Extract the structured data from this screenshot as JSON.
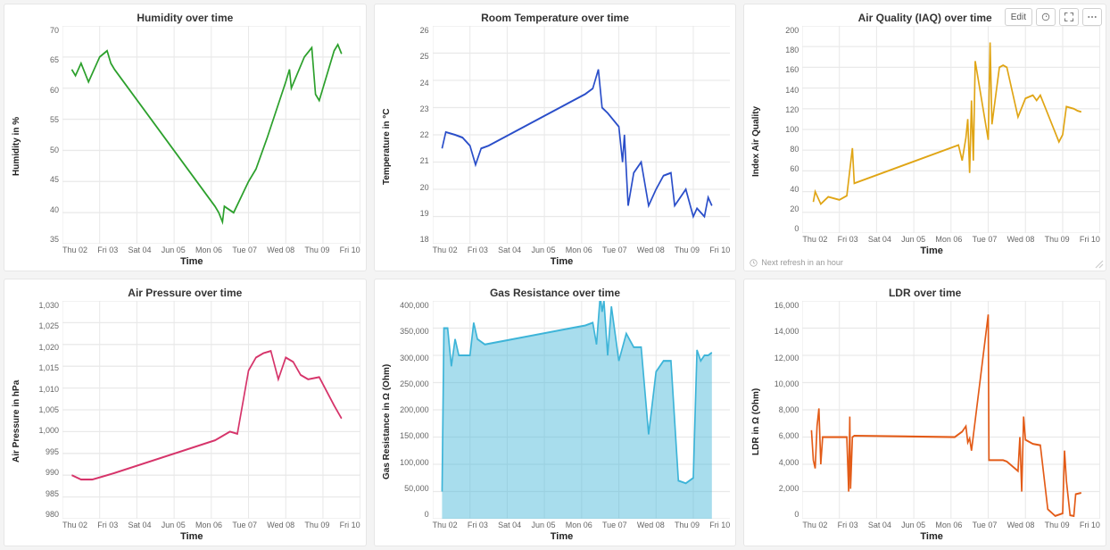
{
  "x_categories": [
    "Thu 02",
    "Fri 03",
    "Sat 04",
    "Jun 05",
    "Mon 06",
    "Tue 07",
    "Wed 08",
    "Thu 09",
    "Fri 10"
  ],
  "xlabel": "Time",
  "toolbar": {
    "edit_label": "Edit"
  },
  "footer": {
    "refresh_label": "Next refresh in an hour"
  },
  "chart_data": [
    {
      "id": "humidity",
      "type": "line",
      "title": "Humidity over time",
      "ylabel": "Humidity in %",
      "ylim": [
        35,
        70
      ],
      "yticks": [
        35,
        40,
        45,
        50,
        55,
        60,
        65,
        70
      ],
      "color": "#2ca02c",
      "series": [
        {
          "name": "humidity",
          "points": [
            [
              0.25,
              63
            ],
            [
              0.35,
              62
            ],
            [
              0.5,
              64
            ],
            [
              0.7,
              61
            ],
            [
              1.0,
              65
            ],
            [
              1.2,
              66
            ],
            [
              1.3,
              64
            ],
            [
              1.4,
              63
            ],
            [
              4.1,
              41
            ],
            [
              4.2,
              40
            ],
            [
              4.3,
              38.5
            ],
            [
              4.35,
              41
            ],
            [
              4.6,
              40
            ],
            [
              5.0,
              45
            ],
            [
              5.2,
              47
            ],
            [
              5.5,
              52
            ],
            [
              6.0,
              61
            ],
            [
              6.1,
              63
            ],
            [
              6.15,
              60
            ],
            [
              6.5,
              65
            ],
            [
              6.7,
              66.5
            ],
            [
              6.8,
              59
            ],
            [
              6.9,
              58
            ],
            [
              7.1,
              62
            ],
            [
              7.3,
              66
            ],
            [
              7.4,
              67
            ],
            [
              7.5,
              65.5
            ]
          ]
        }
      ]
    },
    {
      "id": "room_temp",
      "type": "line",
      "title": "Room Temperature over time",
      "ylabel": "Temperature in °C",
      "ylim": [
        18,
        26
      ],
      "yticks": [
        18,
        19,
        20,
        21,
        22,
        23,
        24,
        25,
        26
      ],
      "color": "#2a4ec9",
      "series": [
        {
          "name": "temp",
          "points": [
            [
              0.25,
              21.5
            ],
            [
              0.35,
              22.1
            ],
            [
              0.6,
              22.0
            ],
            [
              0.8,
              21.9
            ],
            [
              1.0,
              21.6
            ],
            [
              1.15,
              20.9
            ],
            [
              1.3,
              21.5
            ],
            [
              1.5,
              21.6
            ],
            [
              4.1,
              23.5
            ],
            [
              4.3,
              23.7
            ],
            [
              4.45,
              24.4
            ],
            [
              4.55,
              23.0
            ],
            [
              4.7,
              22.8
            ],
            [
              5.0,
              22.3
            ],
            [
              5.1,
              21.0
            ],
            [
              5.15,
              22.0
            ],
            [
              5.25,
              19.4
            ],
            [
              5.4,
              20.6
            ],
            [
              5.6,
              21.0
            ],
            [
              5.8,
              19.4
            ],
            [
              6.0,
              20.0
            ],
            [
              6.2,
              20.5
            ],
            [
              6.4,
              20.6
            ],
            [
              6.5,
              19.4
            ],
            [
              6.8,
              20.0
            ],
            [
              7.0,
              19.0
            ],
            [
              7.1,
              19.3
            ],
            [
              7.3,
              19.0
            ],
            [
              7.4,
              19.7
            ],
            [
              7.5,
              19.4
            ]
          ]
        }
      ]
    },
    {
      "id": "iaq",
      "type": "line",
      "title": "Air Quality (IAQ) over time",
      "ylabel": "Index Air Quality",
      "ylim": [
        0,
        200
      ],
      "yticks": [
        0,
        20,
        40,
        60,
        80,
        100,
        120,
        140,
        160,
        180,
        200
      ],
      "color": "#e0a515",
      "has_toolbar": true,
      "has_footer": true,
      "series": [
        {
          "name": "iaq",
          "points": [
            [
              0.3,
              30
            ],
            [
              0.35,
              40
            ],
            [
              0.5,
              28
            ],
            [
              0.7,
              35
            ],
            [
              1.0,
              32
            ],
            [
              1.2,
              36
            ],
            [
              1.35,
              82
            ],
            [
              1.4,
              48
            ],
            [
              4.2,
              85
            ],
            [
              4.3,
              70
            ],
            [
              4.4,
              92
            ],
            [
              4.45,
              110
            ],
            [
              4.5,
              58
            ],
            [
              4.55,
              128
            ],
            [
              4.6,
              70
            ],
            [
              4.65,
              166
            ],
            [
              5.0,
              90
            ],
            [
              5.05,
              184
            ],
            [
              5.1,
              105
            ],
            [
              5.3,
              160
            ],
            [
              5.4,
              162
            ],
            [
              5.5,
              160
            ],
            [
              5.8,
              112
            ],
            [
              6.0,
              130
            ],
            [
              6.2,
              133
            ],
            [
              6.3,
              128
            ],
            [
              6.4,
              133
            ],
            [
              6.9,
              88
            ],
            [
              7.0,
              95
            ],
            [
              7.1,
              122
            ],
            [
              7.3,
              120
            ],
            [
              7.4,
              118
            ],
            [
              7.5,
              117
            ]
          ]
        }
      ]
    },
    {
      "id": "pressure",
      "type": "line",
      "title": "Air Pressure over time",
      "ylabel": "Air Pressure in hPa",
      "ylim": [
        980,
        1030
      ],
      "yticks": [
        980,
        985,
        990,
        995,
        1000,
        1005,
        1010,
        1015,
        1020,
        1025,
        1030
      ],
      "color": "#d6346a",
      "series": [
        {
          "name": "pressure",
          "points": [
            [
              0.25,
              990
            ],
            [
              0.5,
              989
            ],
            [
              0.8,
              989
            ],
            [
              1.2,
              990
            ],
            [
              1.4,
              990.5
            ],
            [
              4.1,
              998
            ],
            [
              4.3,
              999
            ],
            [
              4.5,
              1000
            ],
            [
              4.7,
              999.5
            ],
            [
              5.0,
              1014
            ],
            [
              5.2,
              1017
            ],
            [
              5.4,
              1018
            ],
            [
              5.6,
              1018.5
            ],
            [
              5.8,
              1012
            ],
            [
              6.0,
              1017
            ],
            [
              6.2,
              1016
            ],
            [
              6.4,
              1013
            ],
            [
              6.6,
              1012
            ],
            [
              6.9,
              1012.5
            ],
            [
              7.3,
              1006
            ],
            [
              7.5,
              1003
            ]
          ]
        }
      ]
    },
    {
      "id": "gas",
      "type": "area",
      "title": "Gas Resistance over time",
      "ylabel": "Gas Resistance in Ω (Ohm)",
      "ylim": [
        0,
        400000
      ],
      "yticks": [
        0,
        50000,
        100000,
        150000,
        200000,
        250000,
        300000,
        350000,
        400000
      ],
      "color": "#3db4d8",
      "fillColor": "rgba(61,180,216,0.45)",
      "series": [
        {
          "name": "gas",
          "points": [
            [
              0.25,
              50000
            ],
            [
              0.3,
              350000
            ],
            [
              0.4,
              350000
            ],
            [
              0.5,
              280000
            ],
            [
              0.6,
              330000
            ],
            [
              0.7,
              300000
            ],
            [
              1.0,
              300000
            ],
            [
              1.1,
              360000
            ],
            [
              1.2,
              330000
            ],
            [
              1.4,
              320000
            ],
            [
              4.1,
              355000
            ],
            [
              4.3,
              360000
            ],
            [
              4.4,
              320000
            ],
            [
              4.5,
              410000
            ],
            [
              4.55,
              380000
            ],
            [
              4.6,
              400000
            ],
            [
              4.7,
              300000
            ],
            [
              4.8,
              390000
            ],
            [
              5.0,
              290000
            ],
            [
              5.2,
              340000
            ],
            [
              5.4,
              315000
            ],
            [
              5.6,
              315000
            ],
            [
              5.8,
              155000
            ],
            [
              6.0,
              270000
            ],
            [
              6.2,
              290000
            ],
            [
              6.4,
              290000
            ],
            [
              6.6,
              70000
            ],
            [
              6.8,
              65000
            ],
            [
              7.0,
              75000
            ],
            [
              7.1,
              310000
            ],
            [
              7.2,
              290000
            ],
            [
              7.3,
              300000
            ],
            [
              7.4,
              300000
            ],
            [
              7.5,
              305000
            ]
          ]
        }
      ]
    },
    {
      "id": "ldr",
      "type": "line",
      "title": "LDR over time",
      "ylabel": "LDR  in Ω (Ohm)",
      "ylim": [
        0,
        16000
      ],
      "yticks": [
        0,
        2000,
        4000,
        6000,
        8000,
        10000,
        12000,
        14000,
        16000
      ],
      "color": "#e35b17",
      "series": [
        {
          "name": "ldr",
          "points": [
            [
              0.25,
              6500
            ],
            [
              0.3,
              4300
            ],
            [
              0.35,
              3700
            ],
            [
              0.4,
              6800
            ],
            [
              0.45,
              8100
            ],
            [
              0.5,
              4000
            ],
            [
              0.55,
              6000
            ],
            [
              0.8,
              6000
            ],
            [
              1.0,
              6000
            ],
            [
              1.2,
              6000
            ],
            [
              1.25,
              2000
            ],
            [
              1.28,
              7500
            ],
            [
              1.3,
              2200
            ],
            [
              1.35,
              6000
            ],
            [
              1.4,
              6100
            ],
            [
              4.1,
              6000
            ],
            [
              4.3,
              6400
            ],
            [
              4.4,
              6800
            ],
            [
              4.45,
              5600
            ],
            [
              4.5,
              5900
            ],
            [
              4.55,
              5000
            ],
            [
              5.0,
              15000
            ],
            [
              5.02,
              4300
            ],
            [
              5.2,
              4300
            ],
            [
              5.3,
              4300
            ],
            [
              5.4,
              4300
            ],
            [
              5.5,
              4200
            ],
            [
              5.8,
              3500
            ],
            [
              5.85,
              6000
            ],
            [
              5.9,
              2000
            ],
            [
              5.95,
              7500
            ],
            [
              6.0,
              5800
            ],
            [
              6.2,
              5500
            ],
            [
              6.4,
              5400
            ],
            [
              6.6,
              700
            ],
            [
              6.8,
              200
            ],
            [
              7.0,
              400
            ],
            [
              7.05,
              5000
            ],
            [
              7.1,
              2800
            ],
            [
              7.2,
              250
            ],
            [
              7.3,
              200
            ],
            [
              7.35,
              1800
            ],
            [
              7.5,
              1900
            ]
          ]
        }
      ]
    }
  ]
}
